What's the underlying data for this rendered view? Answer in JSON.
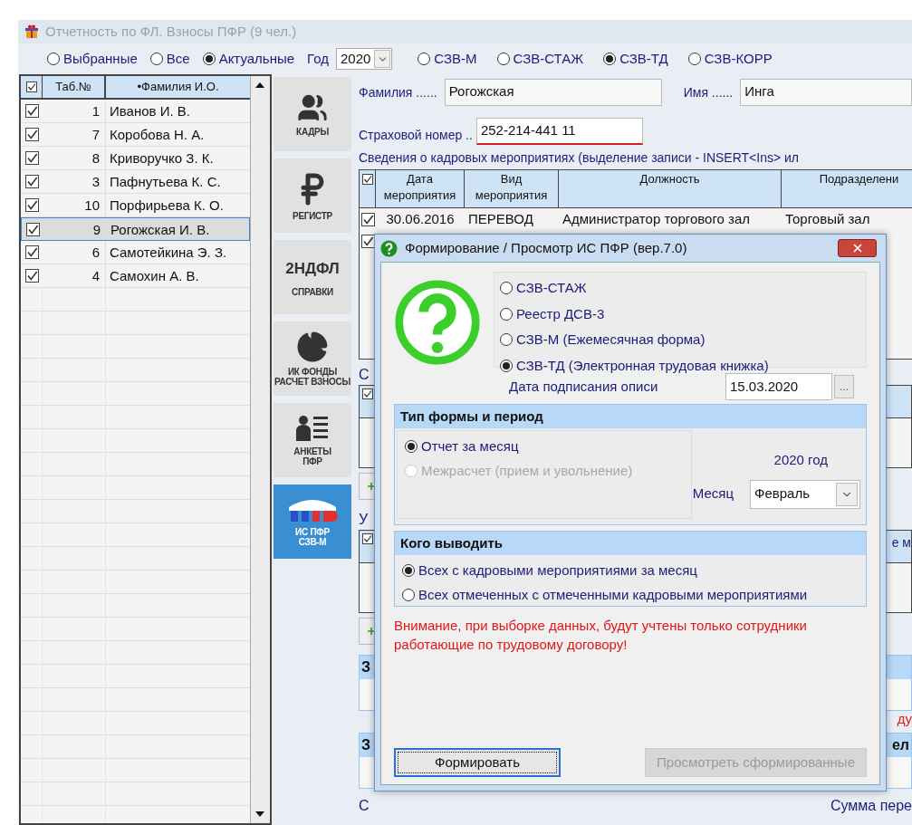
{
  "window": {
    "title": "Отчетность по ФЛ. Взносы ПФР (9 чел.)"
  },
  "filter": {
    "options": [
      {
        "label": "Выбранные",
        "selected": false
      },
      {
        "label": "Все",
        "selected": false
      },
      {
        "label": "Актуальные",
        "selected": true
      }
    ],
    "year_label": "Год",
    "year": "2020",
    "forms": [
      {
        "label": "СЗВ-М",
        "selected": false
      },
      {
        "label": "СЗВ-СТАЖ",
        "selected": false
      },
      {
        "label": "СЗВ-ТД",
        "selected": true
      },
      {
        "label": "СЗВ-КОРР",
        "selected": false
      }
    ]
  },
  "employees": {
    "header_checked": true,
    "columns": [
      "Таб.№",
      "•Фамилия И.О."
    ],
    "rows": [
      {
        "checked": true,
        "number": "1",
        "name": "Иванов И. В.",
        "selected": false
      },
      {
        "checked": true,
        "number": "7",
        "name": "Коробова Н. А.",
        "selected": false
      },
      {
        "checked": true,
        "number": "8",
        "name": "Криворучко З. К.",
        "selected": false
      },
      {
        "checked": true,
        "number": "3",
        "name": "Пафнутьева К. С.",
        "selected": false
      },
      {
        "checked": true,
        "number": "10",
        "name": "Порфирьева К. О.",
        "selected": false
      },
      {
        "checked": true,
        "number": "9",
        "name": "Рогожская И. В.",
        "selected": true
      },
      {
        "checked": true,
        "number": "6",
        "name": "Самотейкина Э. З.",
        "selected": false
      },
      {
        "checked": true,
        "number": "4",
        "name": "Самохин А. В.",
        "selected": false
      }
    ]
  },
  "nav_tabs": [
    {
      "kind": "icon",
      "caption": [
        "КАДРЫ"
      ],
      "selected": false
    },
    {
      "kind": "icon",
      "caption": [
        "РЕГИСТР"
      ],
      "selected": false
    },
    {
      "kind": "heading",
      "heading": "2НДФЛ",
      "caption": [
        "СПРАВКИ"
      ],
      "selected": false
    },
    {
      "kind": "icon",
      "caption": [
        "ИК ФОНДЫ",
        "РАСЧЕТ ВЗНОСЫ"
      ],
      "selected": false
    },
    {
      "kind": "icon",
      "caption": [
        "АНКЕТЫ",
        "ПФР"
      ],
      "selected": false
    },
    {
      "kind": "icon",
      "caption": [
        "ИС ПФР",
        "СЗВ-М"
      ],
      "selected": true
    }
  ],
  "person": {
    "surname_label": "Фамилия ......",
    "surname": "Рогожская",
    "name_label": "Имя ......",
    "name": "Инга",
    "snils_label": "Страховой номер ..",
    "snils": "252-214-441 11"
  },
  "events": {
    "title": "Сведения о кадровых мероприятиях  (выделение записи - INSERT<Ins> ил",
    "header_checked": true,
    "columns": [
      "Дата мероприятия",
      "Вид мероприятия",
      "Должность",
      "Подразделени"
    ],
    "rows": [
      {
        "checked": true,
        "cells": [
          "30.06.2016",
          "ПЕРЕВОД",
          "Администратор торгового зал",
          "Торговый зал"
        ]
      },
      {
        "checked": true
      }
    ]
  },
  "lower": [
    {
      "kind": "label",
      "left": "С"
    },
    {
      "kind": "table",
      "header_checked": true
    },
    {
      "kind": "button"
    },
    {
      "kind": "label",
      "left": "У"
    },
    {
      "kind": "table",
      "header_checked": true,
      "right": "е м"
    },
    {
      "kind": "button"
    },
    {
      "kind": "band",
      "left": "З"
    },
    {
      "kind": "note",
      "right": "ду"
    },
    {
      "kind": "band",
      "left": "З",
      "right": "ел"
    },
    {
      "kind": "label",
      "left": "С",
      "right": "Сумма пере"
    }
  ],
  "dialog": {
    "title": "Формирование / Просмотр ИС ПФР (вер.7.0)",
    "forms": [
      {
        "label": "СЗВ-СТАЖ",
        "selected": false
      },
      {
        "label": "Реестр ДСВ-3",
        "selected": false
      },
      {
        "label": "СЗВ-М (Ежемесячная форма)",
        "selected": false
      },
      {
        "label": "СЗВ-ТД (Электронная трудовая книжка)",
        "selected": true
      }
    ],
    "sign_date_label": "Дата подписания описи",
    "sign_date": "15.03.2020",
    "browse": "...",
    "period": {
      "title": "Тип формы и период",
      "options": [
        {
          "label": "Отчет за месяц",
          "selected": true,
          "disabled": false
        },
        {
          "label": "Межрасчет (прием и увольнение)",
          "selected": false,
          "disabled": true
        }
      ],
      "year": "2020 год",
      "month_label": "Месяц",
      "month": "Февраль"
    },
    "scope": {
      "title": "Кого выводить",
      "options": [
        {
          "label": "Всех с кадровыми мероприятиями за месяц",
          "selected": true
        },
        {
          "label": "Всех отмеченных с отмеченными кадровыми мероприятиями",
          "selected": false
        }
      ]
    },
    "warning": "Внимание, при выборке данных, будут учтены только сотрудники работающие по трудовому договору!",
    "buttons": [
      {
        "label": "Формировать",
        "disabled": false,
        "focused": true
      },
      {
        "label": "Просмотреть сформированные",
        "disabled": true,
        "focused": false
      }
    ]
  }
}
